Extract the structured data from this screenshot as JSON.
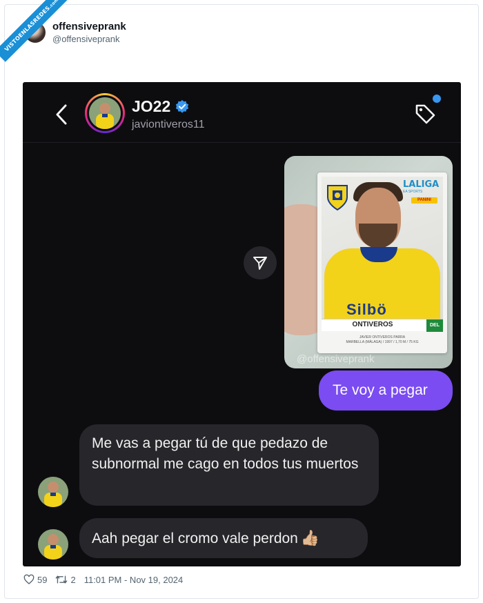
{
  "ribbon": {
    "text": "VISTOENLASREDES",
    "suffix": ".com"
  },
  "author": {
    "name": "offensiveprank",
    "handle": "@offensiveprank"
  },
  "dm": {
    "contact_name": "JO22",
    "contact_handle": "javiontiveros11",
    "icons": {
      "back": "chevron-left-icon",
      "verified": "verified-badge-icon",
      "tag": "tag-icon",
      "share": "send-icon"
    },
    "accent": "#3897f0"
  },
  "sticker": {
    "league": "LALIGA",
    "league_sub": "EA SPORTS",
    "brand": "PANINI",
    "sponsor": "Silbö",
    "name": "ONTIVEROS",
    "position": "DEL",
    "info_line1": "JAVIER ONTIVEROS PARRA",
    "info_line2": "MARBELLA (MÁLAGA) / 1997 / 1,70 M / 75 KG",
    "watermark": "@offensiveprank"
  },
  "messages": {
    "outgoing": "Te voy a pegar",
    "incoming1": "Me vas a pegar tú de que pedazo de subnormal me cago en todos tus muertos",
    "incoming2": "Aah pegar el cromo vale perdon",
    "emoji": "👍🏼",
    "outgoing_color": "#7a4cf2",
    "incoming_color": "#26262b"
  },
  "tweet_footer": {
    "likes": "59",
    "retweets": "2",
    "timestamp": "11:01 PM - Nov 19, 2024"
  }
}
